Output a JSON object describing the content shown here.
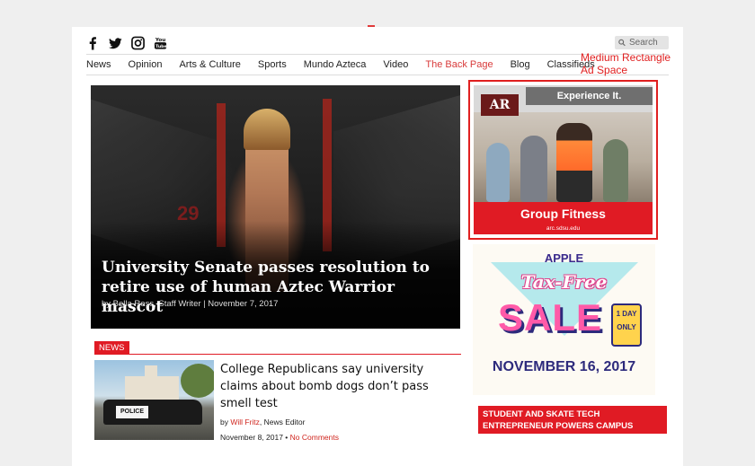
{
  "social": {
    "icons": [
      "facebook-icon",
      "twitter-icon",
      "instagram-icon",
      "youtube-icon"
    ]
  },
  "search": {
    "placeholder": "Search"
  },
  "nav": {
    "items": [
      "News",
      "Opinion",
      "Arts & Culture",
      "Sports",
      "Mundo Azteca",
      "Video",
      "The Back Page",
      "Blog",
      "Classifieds"
    ],
    "active": "The Back Page"
  },
  "ad_label": "Medium Rectangle Ad Space",
  "hero": {
    "jersey": "29",
    "headline": "University Senate passes resolution to retire use of human Aztec Warrior mascot",
    "byline": "by Bella Ross, Staff Writer | November 7, 2017"
  },
  "ad_rec": {
    "logo": "AR",
    "tagline": "Experience It.",
    "title": "Group Fitness",
    "url": "arc.sdsu.edu"
  },
  "sale_ad": {
    "brand": "APPLE",
    "line1": "Tax-Free",
    "line2": "SALE",
    "badge": "1 DAY ONLY",
    "date": "NOVEMBER 16, 2017"
  },
  "promo_headline": "STUDENT AND SKATE TECH ENTREPRENEUR POWERS CAMPUS SKATERS",
  "section_tag": "NEWS",
  "story": {
    "thumb_label": "POLICE",
    "title": "College Republicans say university claims about bomb dogs don’t pass smell test",
    "by_prefix": "by ",
    "author": "Will Fritz",
    "role": ", News Editor",
    "date": "November 8, 2017 • ",
    "comments": "No Comments"
  },
  "colors": {
    "accent_red": "#e01b24",
    "nav_active": "#d83a3a",
    "sale_pink": "#ff5aa8",
    "sale_navy": "#2d2a7c"
  }
}
